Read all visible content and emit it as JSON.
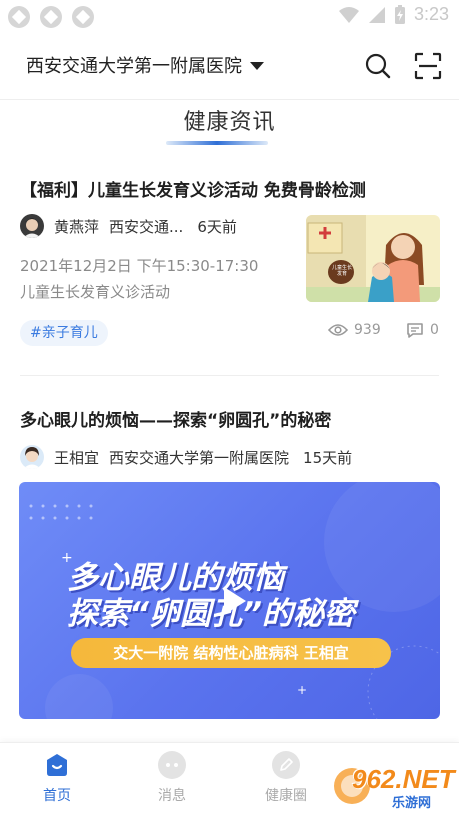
{
  "status_bar": {
    "time": "3:23"
  },
  "header": {
    "hospital_name": "西安交通大学第一附属医院",
    "icons": [
      "search-icon",
      "scan-icon"
    ]
  },
  "section": {
    "title": "健康资讯"
  },
  "articles": [
    {
      "title": "【福利】儿童生长发育义诊活动 免费骨龄检测",
      "author": "黄燕萍",
      "org": "西安交通...",
      "time": "6天前",
      "desc_line1": "2021年12月2日 下午15:30-17:30",
      "desc_line2": "儿童生长发育义诊活动",
      "tag": "#亲子育儿",
      "views": "939",
      "comments": "0",
      "thumb_sign": "儿童生长发育"
    },
    {
      "title": "多心眼儿的烦恼——探索“卵圆孔”的秘密",
      "author": "王相宜",
      "org": "西安交通大学第一附属医院",
      "time": "15天前",
      "video": {
        "line1": "多心眼儿的烦恼",
        "line2": "探索“卵圆孔”的秘密",
        "banner": "交大一附院  结构性心脏病科  王相宜"
      }
    }
  ],
  "bottom_nav": [
    {
      "label": "首页",
      "icon": "home-icon",
      "active": true
    },
    {
      "label": "消息",
      "icon": "message-icon",
      "active": false
    },
    {
      "label": "健康圈",
      "icon": "health-circle-icon",
      "active": false
    }
  ],
  "watermark": {
    "text": "962.NET",
    "sub": "乐游网"
  },
  "colors": {
    "accent": "#2f6fd6",
    "tag_bg": "#eef4fc",
    "video_bg": "#5a73ee",
    "banner": "#f5b83b"
  }
}
